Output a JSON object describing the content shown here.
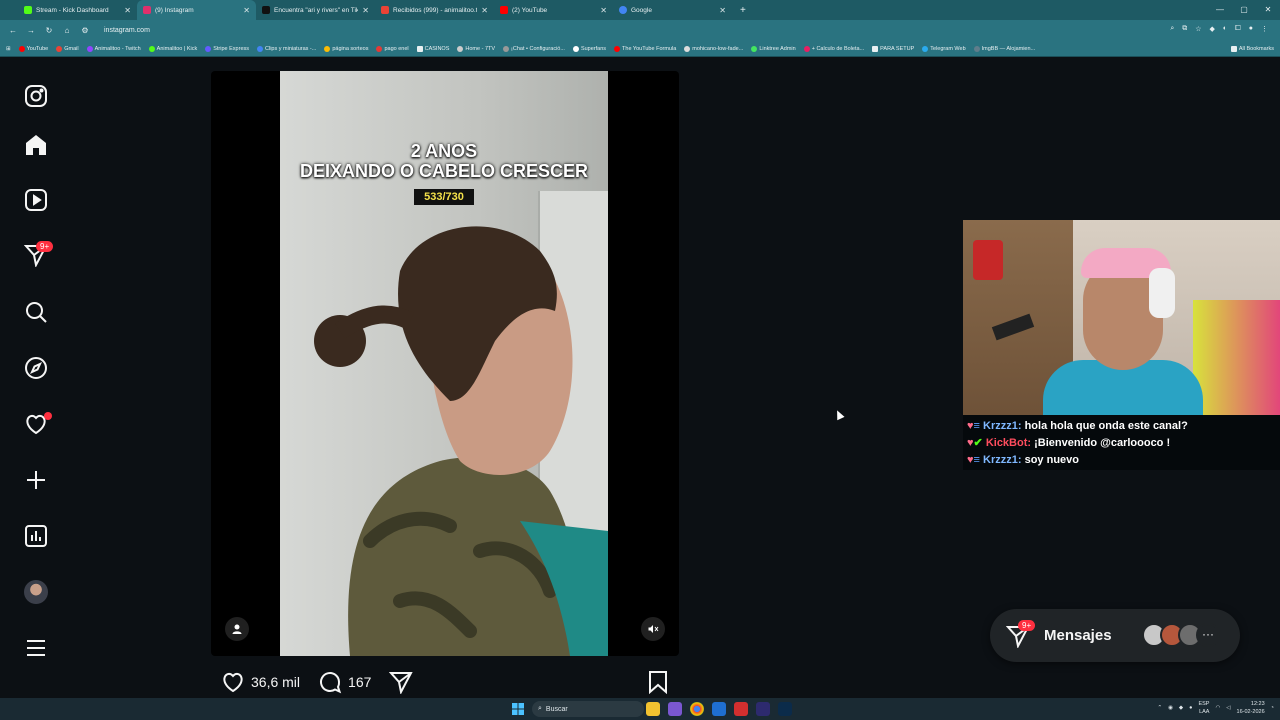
{
  "browser": {
    "tabs": [
      {
        "title": "Stream - Kick Dashboard",
        "color": "#53fc18"
      },
      {
        "title": "(9) Instagram",
        "color": "#e1306c"
      },
      {
        "title": "Encuentra \"ari y rivers\" en TikTok",
        "color": "#111111"
      },
      {
        "title": "Recibidos (999) - animalitoo.t...",
        "color": "#ea4335"
      },
      {
        "title": "(2) YouTube",
        "color": "#ff0000"
      },
      {
        "title": "Google",
        "color": "#4285f4"
      }
    ],
    "url": "instagram.com",
    "bookmarks": [
      "YouTube",
      "Gmail",
      "Animalitoo - Twitch",
      "Animalitoo | Kick",
      "Stripe Express",
      "Clips y miniaturas -...",
      "página sorteos",
      "pago enel",
      "CASINOS",
      "Home - 7TV",
      "¡Chat • Configuració...",
      "Superfans",
      "The YouTube Formula",
      "mohicano-low-fade...",
      "Linktree Admin",
      "+ Calculo de Boleta...",
      "PARA SETUP",
      "Telegram Web",
      "ImgBB — Alojamien..."
    ],
    "bookmarks_all": "All Bookmarks"
  },
  "sidebar": {
    "icons": [
      "instagram-logo-icon",
      "home-icon",
      "reels-icon",
      "messages-icon",
      "search-icon",
      "explore-icon",
      "notifications-icon",
      "create-icon",
      "dashboard-icon",
      "profile-avatar",
      "more-menu-icon"
    ],
    "messages_badge": "9+"
  },
  "reel": {
    "overlay_title_line1": "2 ANOS",
    "overlay_title_line2": "DEIXANDO O CABELO CRESCER",
    "counter": "533/730",
    "likes": "36,6 mil",
    "comments": "167"
  },
  "stream_chat": [
    {
      "user": "Krzzz1:",
      "text": " hola hola que onda este canal?",
      "type": "user"
    },
    {
      "user": "KickBot:",
      "text": " ¡Bienvenido @carloooco !",
      "type": "bot"
    },
    {
      "user": "Krzzz1:",
      "text": " soy nuevo",
      "type": "user"
    }
  ],
  "messages_button": {
    "label": "Mensajes",
    "badge": "9+"
  },
  "taskbar": {
    "search_placeholder": "Buscar",
    "lang": "ESP",
    "lang_sub": "LAA",
    "time": "12:23",
    "date": "16-02-2026"
  },
  "colors": {
    "accent_red": "#ff3040",
    "background": "#0c1014",
    "counter_yellow": "#f4e14a"
  }
}
